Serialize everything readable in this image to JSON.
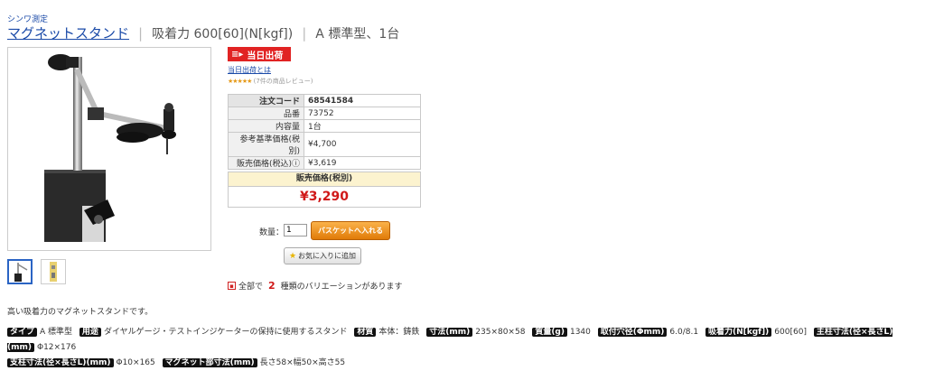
{
  "brand": "シンワ測定",
  "title": {
    "name": "マグネットスタンド",
    "spec1": "吸着力 600[60](N[kgf])",
    "spec2": "A 標準型、1台"
  },
  "badge": {
    "same_day": "当日出荷",
    "same_day_link": "当日出荷とは"
  },
  "rating": {
    "stars": "★★★★★",
    "review_text": "(7件の商品レビュー)"
  },
  "info_table": [
    {
      "label": "注文コード",
      "value": "68541584"
    },
    {
      "label": "品番",
      "value": "73752"
    },
    {
      "label": "内容量",
      "value": "1台"
    },
    {
      "label": "参考基準価格(税別)",
      "value": "¥4,700"
    },
    {
      "label": "販売価格(税込)ⓘ",
      "value": "¥3,619"
    }
  ],
  "sale": {
    "label": "販売価格(税別)",
    "price": "¥3,290"
  },
  "cart": {
    "qty_label": "数量：",
    "qty_value": "1",
    "basket_button": "バスケットへ入れる",
    "favorite_button": "お気に入りに追加"
  },
  "variation": {
    "prefix": "全部で",
    "count": "2",
    "suffix": "種類のバリエーションがあります"
  },
  "description": "高い吸着力のマグネットスタンドです。",
  "specs": [
    {
      "tag": "タイプ",
      "value": "A 標準型"
    },
    {
      "tag": "用途",
      "value": "ダイヤルゲージ・テストインジケーターの保持に使用するスタンド"
    },
    {
      "tag": "材質",
      "value": "本体：鋳鉄"
    },
    {
      "tag": "寸法(mm)",
      "value": "235×80×58"
    },
    {
      "tag": "質量(g)",
      "value": "1340"
    },
    {
      "tag": "取付穴径(Φmm)",
      "value": "6.0/8.1"
    },
    {
      "tag": "吸着力(N[kgf])",
      "value": "600[60]"
    },
    {
      "tag": "主柱寸法(径×長さL)(mm)",
      "value": "Φ12×176"
    },
    {
      "tag": "支柱寸法(径×長さL)(mm)",
      "value": "Φ10×165"
    },
    {
      "tag": "マグネット部寸法(mm)",
      "value": "長さ58×幅50×高さ55"
    }
  ],
  "colors": {
    "link": "#1a4aa8",
    "accent_red": "#d01818",
    "basket_orange": "#f39c1f"
  }
}
